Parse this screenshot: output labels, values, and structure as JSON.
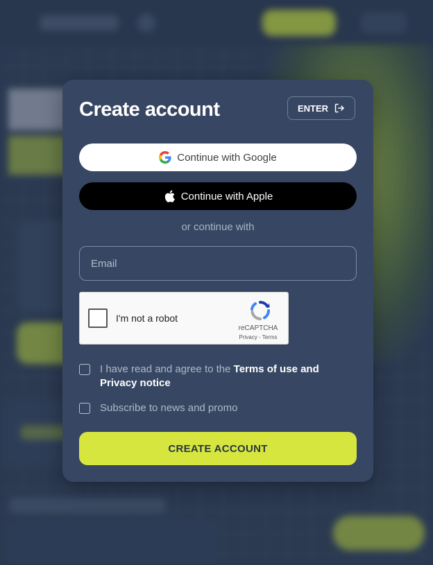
{
  "modal": {
    "title": "Create account",
    "enter_label": "ENTER",
    "google_label": "Continue with Google",
    "apple_label": "Continue with Apple",
    "divider_text": "or continue with",
    "email_placeholder": "Email",
    "email_value": "",
    "recaptcha": {
      "label": "I'm not a robot",
      "brand": "reCAPTCHA",
      "links": "Privacy - Terms",
      "checked": false
    },
    "terms": {
      "prefix": "I have read and agree to the ",
      "link": "Terms of use and Privacy notice",
      "checked": false
    },
    "promo": {
      "label": "Subscribe to news and promo",
      "checked": false
    },
    "submit_label": "CREATE ACCOUNT"
  },
  "colors": {
    "modal_bg": "#374763",
    "accent": "#d6e63f",
    "page_bg": "#2b3a52"
  },
  "icons": {
    "enter": "enter-arrow-icon",
    "google": "google-icon",
    "apple": "apple-icon",
    "recaptcha": "recaptcha-logo-icon"
  }
}
